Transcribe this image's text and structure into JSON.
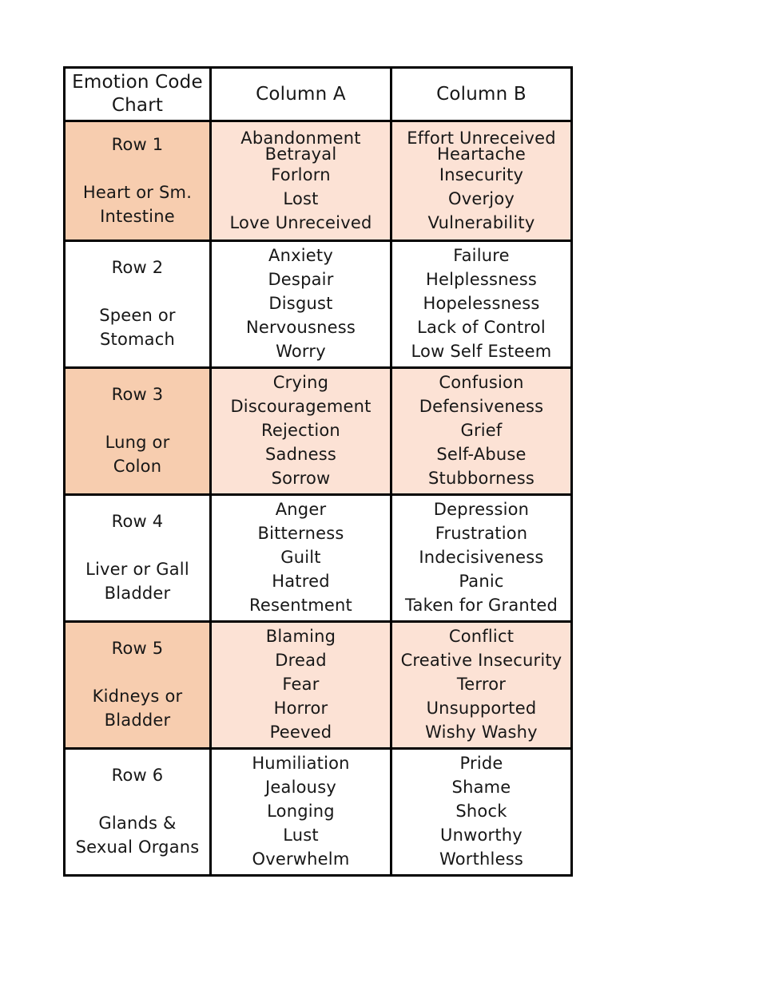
{
  "document": {
    "title": "Emotion Code Chart"
  },
  "table": {
    "headers": {
      "corner": "Emotion Code\nChart",
      "corner_line1": "Emotion Code",
      "corner_line2": "Chart",
      "column_a": "Column A",
      "column_b": "Column B"
    },
    "rows": [
      {
        "row_label": "Row 1",
        "organ": "Heart or Sm.\nIntestine",
        "organ_line1": "Heart or Sm.",
        "organ_line2": "Intestine",
        "shaded": true,
        "column_a": [
          "Abandonment",
          "Betrayal",
          "Forlorn",
          "Lost",
          "Love Unreceived"
        ],
        "column_b": [
          "Effort Unreceived",
          "Heartache",
          "Insecurity",
          "Overjoy",
          "Vulnerability"
        ]
      },
      {
        "row_label": "Row 2",
        "organ": "Speen or\nStomach",
        "organ_line1": "Speen or",
        "organ_line2": "Stomach",
        "shaded": false,
        "column_a": [
          "Anxiety",
          "Despair",
          "Disgust",
          "Nervousness",
          "Worry"
        ],
        "column_b": [
          "Failure",
          "Helplessness",
          "Hopelessness",
          "Lack of Control",
          "Low Self Esteem"
        ]
      },
      {
        "row_label": "Row 3",
        "organ": "Lung or\nColon",
        "organ_line1": "Lung or",
        "organ_line2": "Colon",
        "shaded": true,
        "column_a": [
          "Crying",
          "Discouragement",
          "Rejection",
          "Sadness",
          "Sorrow"
        ],
        "column_b": [
          "Confusion",
          "Defensiveness",
          "Grief",
          "Self-Abuse",
          "Stubborness"
        ]
      },
      {
        "row_label": "Row 4",
        "organ": "Liver or Gall\nBladder",
        "organ_line1": "Liver or Gall",
        "organ_line2": "Bladder",
        "shaded": false,
        "column_a": [
          "Anger",
          "Bitterness",
          "Guilt",
          "Hatred",
          "Resentment"
        ],
        "column_b": [
          "Depression",
          "Frustration",
          "Indecisiveness",
          "Panic",
          "Taken for Granted"
        ]
      },
      {
        "row_label": "Row 5",
        "organ": "Kidneys or\nBladder",
        "organ_line1": "Kidneys or",
        "organ_line2": "Bladder",
        "shaded": true,
        "column_a": [
          "Blaming",
          "Dread",
          "Fear",
          "Horror",
          "Peeved"
        ],
        "column_b": [
          "Conflict",
          "Creative Insecurity",
          "Terror",
          "Unsupported",
          "Wishy Washy"
        ]
      },
      {
        "row_label": "Row 6",
        "organ": "Glands &\nSexual Organs",
        "organ_line1": "Glands &",
        "organ_line2": "Sexual Organs",
        "shaded": false,
        "column_a": [
          "Humiliation",
          "Jealousy",
          "Longing",
          "Lust",
          "Overwhelm"
        ],
        "column_b": [
          "Pride",
          "Shame",
          "Shock",
          "Unworthy",
          "Worthless"
        ]
      }
    ]
  },
  "colors": {
    "border": "#000000",
    "text": "#171717",
    "label_cell_shaded": "#f7cdaf",
    "data_cell_shaded": "#fce2d5",
    "cell_plain": "#ffffff",
    "page_background": "#ffffff"
  }
}
